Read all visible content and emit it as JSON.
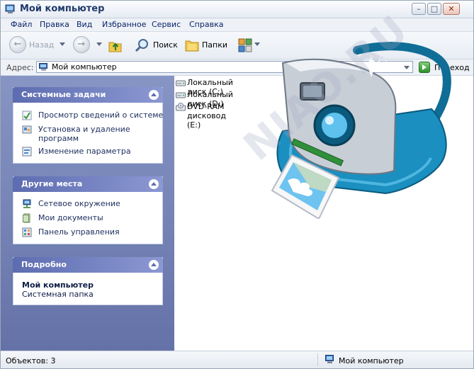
{
  "window": {
    "title": "Мой компьютер",
    "controls": {
      "minimize": "–",
      "maximize": "□",
      "close": "✕"
    }
  },
  "menu": [
    "Файл",
    "Правка",
    "Вид",
    "Избранное",
    "Сервис",
    "Справка"
  ],
  "toolbar": {
    "back_label": "Назад",
    "search_label": "Поиск",
    "folders_label": "Папки"
  },
  "address": {
    "label": "Адрес:",
    "value": "Мой компьютер",
    "go_label": "Переход"
  },
  "sidebar": {
    "system_tasks": {
      "title": "Системные задачи",
      "items": [
        {
          "label": "Просмотр сведений о системе",
          "icon": "system-info-icon"
        },
        {
          "label": "Установка и удаление программ",
          "icon": "add-remove-programs-icon"
        },
        {
          "label": "Изменение параметра",
          "icon": "change-setting-icon"
        }
      ]
    },
    "other_places": {
      "title": "Другие места",
      "items": [
        {
          "label": "Сетевое окружение",
          "icon": "network-icon"
        },
        {
          "label": "Мои документы",
          "icon": "my-documents-icon"
        },
        {
          "label": "Панель управления",
          "icon": "control-panel-icon"
        }
      ]
    },
    "details": {
      "title": "Подробно",
      "name": "Мой компьютер",
      "type": "Системная папка"
    }
  },
  "drives": [
    {
      "label": "Локальный диск (C:)",
      "icon": "hard-drive-icon"
    },
    {
      "label": "Локальный диск (D:)",
      "icon": "hard-drive-icon"
    },
    {
      "label": "DVD-RAM дисковод (E:)",
      "icon": "dvd-drive-icon"
    }
  ],
  "status": {
    "left": "Объектов: 3",
    "right": "Мой компьютер"
  },
  "watermark": "NIAO.RU",
  "colors": {
    "sidebar_gradient_top": "#8795c4",
    "sidebar_gradient_bottom": "#6472a8",
    "task_header": "#5d6cb0",
    "camera_body": "#1a8fc0"
  }
}
